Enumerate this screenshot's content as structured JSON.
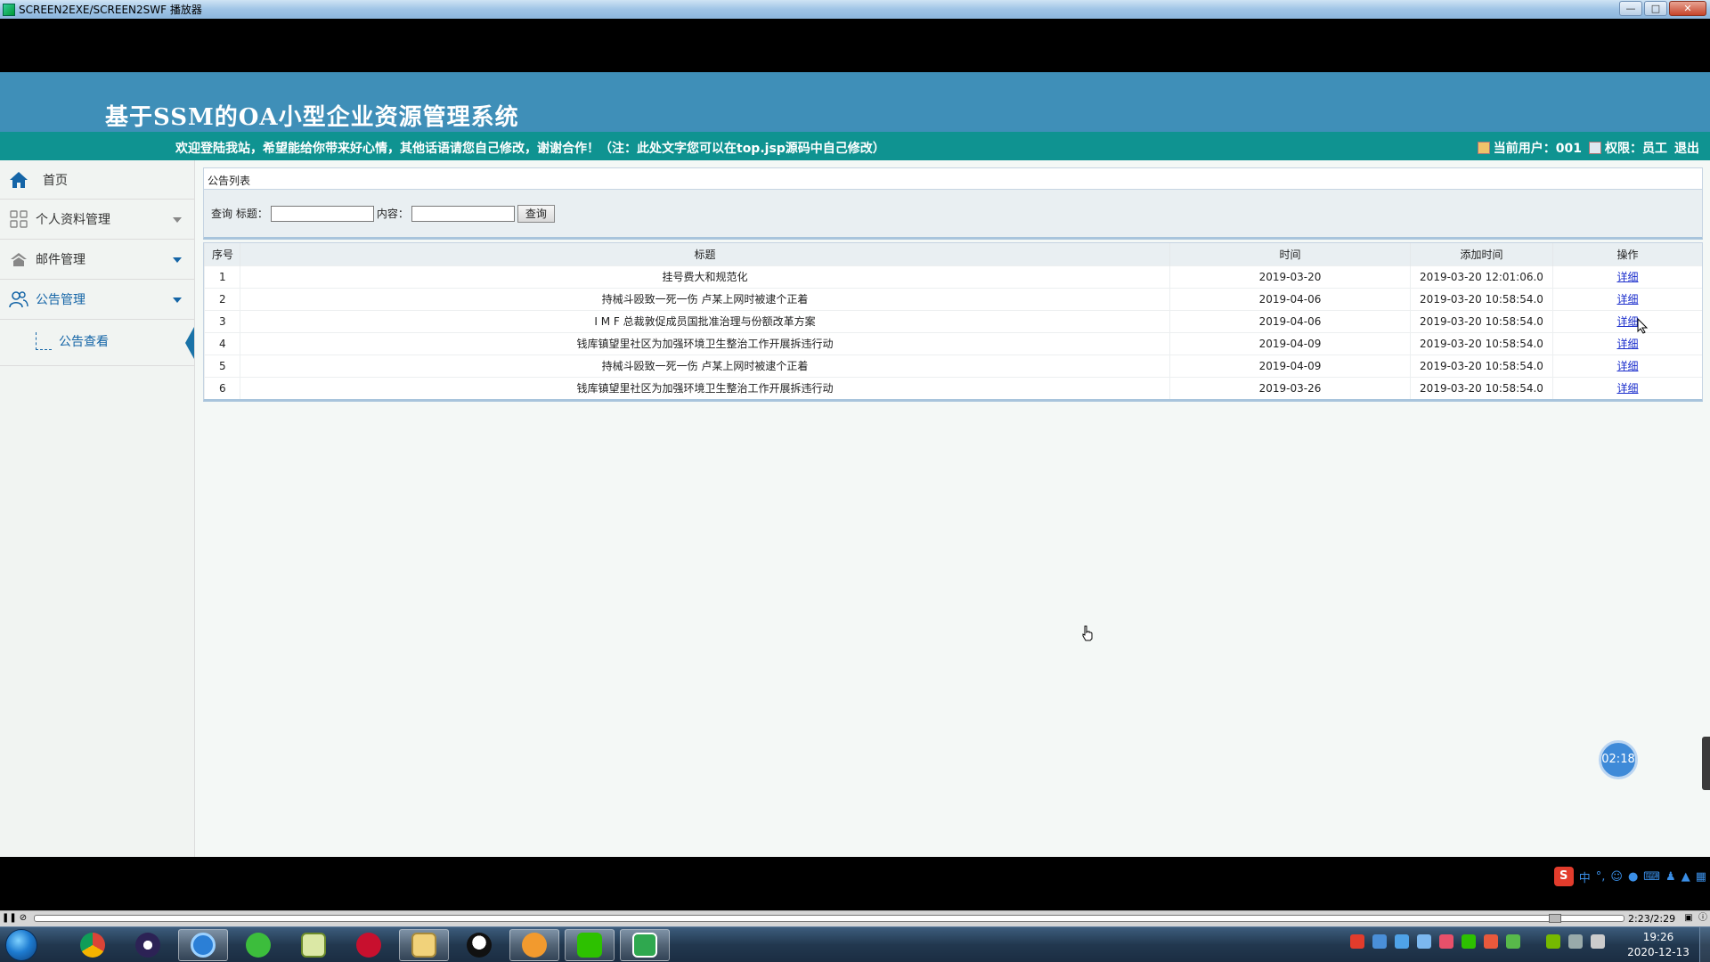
{
  "player": {
    "window_title": "SCREEN2EXE/SCREEN2SWF 播放器",
    "time_readout": "2:23/2:29",
    "float_timer": "02:18",
    "progress": 0.96
  },
  "site": {
    "system_title": "基于SSM的OA小型企业资源管理系统",
    "welcome": "欢迎登陆我站，希望能给你带来好心情，其他话语请您自己修改，谢谢合作！（注：此处文字您可以在top.jsp源码中自己修改）",
    "current_user": "当前用户：001",
    "permission": "权限：员工",
    "logout": "退出"
  },
  "sidebar": {
    "home": "首页",
    "items": [
      {
        "label": "个人资料管理",
        "icon": "grid-icon"
      },
      {
        "label": "邮件管理",
        "icon": "house-icon"
      },
      {
        "label": "公告管理",
        "icon": "users-icon"
      }
    ],
    "submenu_item": "公告查看"
  },
  "main": {
    "panel_title": "公告列表",
    "search": {
      "query_label": "查询 标题：",
      "content_label": "内容：",
      "title_value": "",
      "content_value": "",
      "button": "查询"
    },
    "table": {
      "headers": [
        "序号",
        "标题",
        "时间",
        "添加时间",
        "操作"
      ],
      "rows": [
        {
          "seq": "1",
          "title": "挂号费大和规范化",
          "date": "2019-03-20",
          "added": "2019-03-20 12:01:06.0",
          "op": "详细"
        },
        {
          "seq": "2",
          "title": "持械斗殴致一死一伤 卢某上网时被逮个正着",
          "date": "2019-04-06",
          "added": "2019-03-20 10:58:54.0",
          "op": "详细"
        },
        {
          "seq": "3",
          "title": "I M F 总裁敦促成员国批准治理与份额改革方案",
          "date": "2019-04-06",
          "added": "2019-03-20 10:58:54.0",
          "op": "详细"
        },
        {
          "seq": "4",
          "title": "钱库镇望里社区为加强环境卫生整治工作开展拆违行动",
          "date": "2019-04-09",
          "added": "2019-03-20 10:58:54.0",
          "op": "详细"
        },
        {
          "seq": "5",
          "title": "持械斗殴致一死一伤 卢某上网时被逮个正着",
          "date": "2019-04-09",
          "added": "2019-03-20 10:58:54.0",
          "op": "详细"
        },
        {
          "seq": "6",
          "title": "钱库镇望里社区为加强环境卫生整治工作开展拆违行动",
          "date": "2019-03-26",
          "added": "2019-03-20 10:58:54.0",
          "op": "详细"
        }
      ]
    }
  },
  "ime": {
    "logo": "S",
    "mode": "中"
  },
  "taskbar": {
    "apps": [
      "chrome-icon",
      "eclipse-icon",
      "browser-icon",
      "360-icon",
      "notepad-icon",
      "flash-icon",
      "file-explorer-icon",
      "qq-icon",
      "audio-icon",
      "wechat-icon",
      "screen-player-icon"
    ],
    "clock_time": "19:26",
    "clock_date": "2020-12-13"
  },
  "colors": {
    "header": "#3f8fb8",
    "welcome_bar": "#0f9391",
    "accent": "#1565a7",
    "link": "#1a2dcc"
  }
}
